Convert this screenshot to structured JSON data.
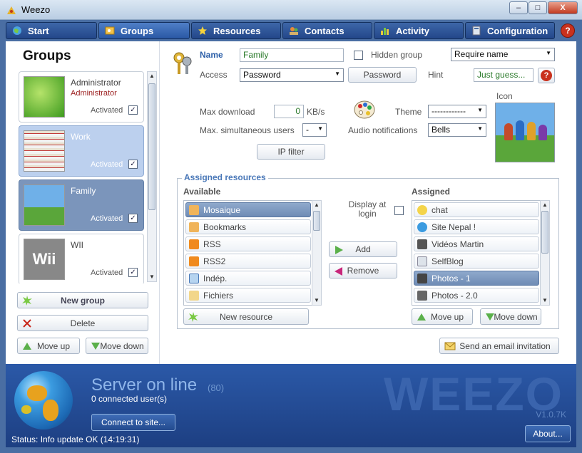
{
  "window": {
    "title": "Weezo",
    "minimize": "–",
    "maximize": "□",
    "close": "X"
  },
  "tabs": [
    {
      "label": "Start"
    },
    {
      "label": "Groups"
    },
    {
      "label": "Resources"
    },
    {
      "label": "Contacts"
    },
    {
      "label": "Activity"
    },
    {
      "label": "Configuration"
    }
  ],
  "help_label": "?",
  "groups_panel": {
    "title": "Groups",
    "groups": [
      {
        "name": "Administrator",
        "role": "Administrator",
        "status": "Activated",
        "checked": "✓"
      },
      {
        "name": "Work",
        "role": "",
        "status": "Activated",
        "checked": "✓"
      },
      {
        "name": "Family",
        "role": "",
        "status": "Activated",
        "checked": "✓"
      },
      {
        "name": "WII",
        "role": "",
        "status": "Activated",
        "checked": "✓"
      }
    ],
    "thumb_text_wii": "Wii",
    "new_group": "New group",
    "delete": "Delete",
    "move_up": "Move up",
    "move_down": "Move down"
  },
  "form": {
    "name_label": "Name",
    "name_value": "Family",
    "hidden_group_label": "Hidden group",
    "require_select": "Require name",
    "access_label": "Access",
    "access_select": "Password",
    "password_button": "Password",
    "hint_label": "Hint",
    "hint_value": "Just guess...",
    "icon_label": "Icon",
    "max_download_label": "Max download",
    "max_download_value": "0",
    "max_download_unit": "KB/s",
    "theme_label": "Theme",
    "theme_select": "------------",
    "max_users_label": "Max. simultaneous users",
    "max_users_select": "-",
    "audio_label": "Audio notifications",
    "audio_select": "Bells",
    "ip_filter": "IP filter"
  },
  "resources": {
    "section_title": "Assigned resources",
    "available_label": "Available",
    "assigned_label": "Assigned",
    "display_at_login": "Display at login",
    "available": [
      "Mosaique",
      "Bookmarks",
      "RSS",
      "RSS2",
      "Indép.",
      "Fichiers"
    ],
    "assigned": [
      "chat",
      "Site Nepal !",
      "Vidéos Martin",
      "SelfBlog",
      "Photos - 1",
      "Photos - 2.0"
    ],
    "add": "Add",
    "remove": "Remove",
    "new_resource": "New resource",
    "move_up": "Move up",
    "move_down": "Move down",
    "email_invitation": "Send an email invitation"
  },
  "footer": {
    "server_status": "Server on line",
    "server_count": "(80)",
    "connected": "0 connected user(s)",
    "connect_button": "Connect to site...",
    "brand": "WEEZO",
    "version": "V1.0.7K",
    "about": "About...",
    "status": "Status: Info update OK (14:19:31)"
  },
  "colors": {
    "accent": "#2b59a8",
    "selected": "#7b95bb",
    "link": "#2c5fa8"
  }
}
